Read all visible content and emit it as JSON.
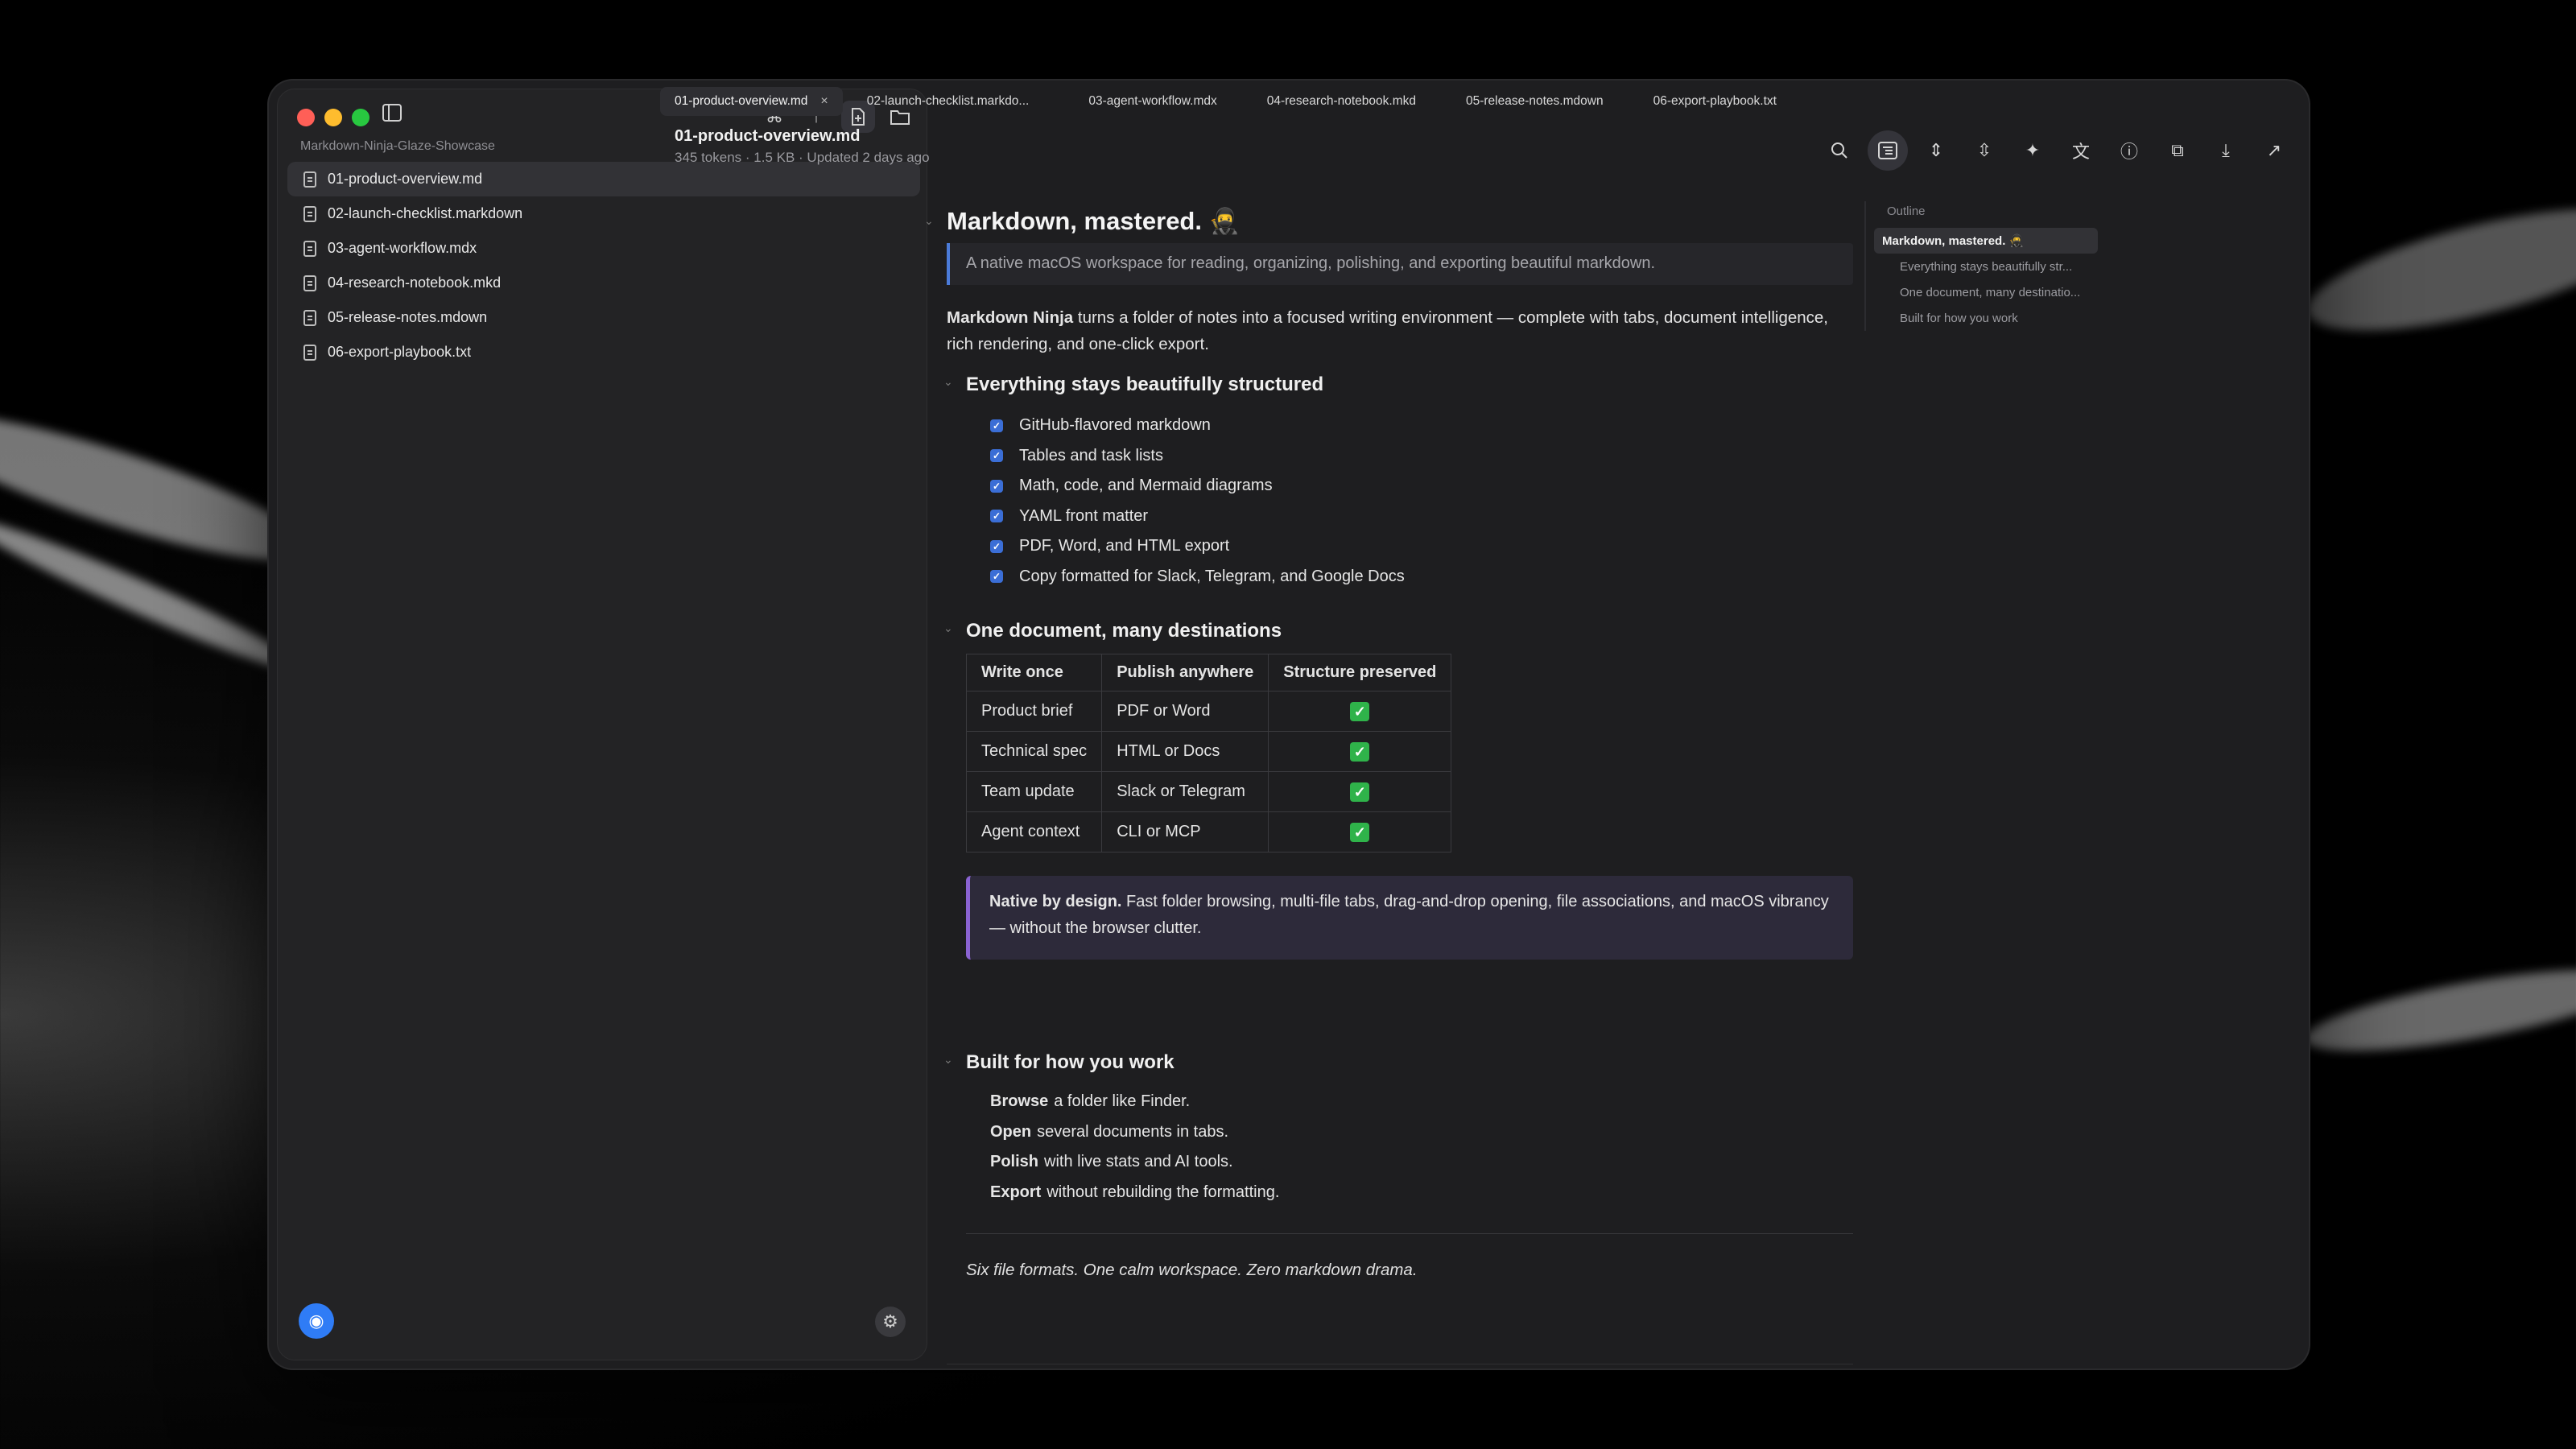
{
  "sidebar": {
    "workspace_name": "Markdown-Ninja-Glaze-Showcase",
    "files": [
      {
        "name": "01-product-overview.md",
        "active": true
      },
      {
        "name": "02-launch-checklist.markdown",
        "active": false
      },
      {
        "name": "03-agent-workflow.mdx",
        "active": false
      },
      {
        "name": "04-research-notebook.mkd",
        "active": false
      },
      {
        "name": "05-release-notes.mdown",
        "active": false
      },
      {
        "name": "06-export-playbook.txt",
        "active": false
      }
    ]
  },
  "tabs": [
    {
      "label": "01-product-overview.md",
      "active": true,
      "close": "×"
    },
    {
      "label": "02-launch-checklist.markdo...",
      "active": false
    },
    {
      "label": "03-agent-workflow.mdx",
      "active": false
    },
    {
      "label": "04-research-notebook.mkd",
      "active": false
    },
    {
      "label": "05-release-notes.mdown",
      "active": false
    },
    {
      "label": "06-export-playbook.txt",
      "active": false
    }
  ],
  "document": {
    "title": "01-product-overview.md",
    "meta": "345 tokens · 1.5 KB · Updated 2 days ago",
    "h1": "Markdown, mastered. 🥷",
    "quote": "A native macOS workspace for reading, organizing, polishing, and exporting beautiful markdown.",
    "intro_bold": "Markdown Ninja",
    "intro_rest": " turns a folder of notes into a focused writing environment — complete with tabs, document intelligence, rich rendering, and one-click export.",
    "section1": {
      "heading": "Everything stays beautifully structured",
      "items": [
        "GitHub-flavored markdown",
        "Tables and task lists",
        "Math, code, and Mermaid diagrams",
        "YAML front matter",
        "PDF, Word, and HTML export",
        "Copy formatted for Slack, Telegram, and Google Docs"
      ],
      "check_glyph": "✓"
    },
    "section2": {
      "heading": "One document, many destinations",
      "headers": [
        "Write once",
        "Publish anywhere",
        "Structure preserved"
      ],
      "rows": [
        [
          "Product brief",
          "PDF or Word",
          "✓"
        ],
        [
          "Technical spec",
          "HTML or Docs",
          "✓"
        ],
        [
          "Team update",
          "Slack or Telegram",
          "✓"
        ],
        [
          "Agent context",
          "CLI or MCP",
          "✓"
        ]
      ]
    },
    "callout_bold": "Native by design.",
    "callout_rest": " Fast folder browsing, multi-file tabs, drag-and-drop opening, file associations, and macOS vibrancy — without the browser clutter.",
    "section3": {
      "heading": "Built for how you work",
      "items": [
        {
          "bold": "Browse",
          "rest": "a folder like Finder."
        },
        {
          "bold": "Open",
          "rest": "several documents in tabs."
        },
        {
          "bold": "Polish",
          "rest": "with live stats and AI tools."
        },
        {
          "bold": "Export",
          "rest": "without rebuilding the formatting."
        }
      ]
    },
    "closing": "Six file formats. One calm workspace. Zero markdown drama."
  },
  "outline": {
    "title": "Outline",
    "items": [
      "Markdown, mastered. 🥷",
      "Everything stays beautifully str...",
      "One document, many destinatio...",
      "Built for how you work"
    ]
  },
  "icons": {
    "sidebar_toggle": "▯",
    "command": "⌘",
    "up": "↑",
    "new_file": "+",
    "folder": "▭",
    "eye": "◉",
    "gear": "⚙",
    "search": "⌕",
    "outline": "☰",
    "collapse": "⇕",
    "expand": "⇳",
    "sparkle": "✦",
    "translate": "文",
    "info": "ⓘ",
    "copy": "⧉",
    "download": "⤓",
    "share": "↗",
    "fold": "⌄"
  },
  "colors": {
    "accent_blue": "#2f7cf6",
    "callout_purple": "#8a63d2",
    "check_green": "#2fb34a"
  }
}
